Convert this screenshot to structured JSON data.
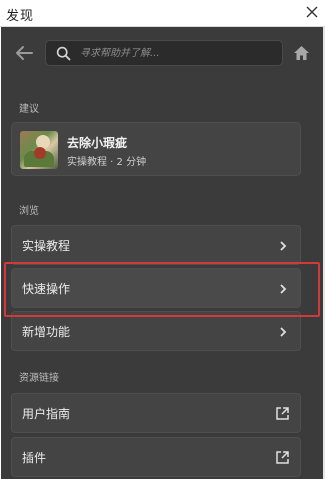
{
  "window": {
    "title": "发现"
  },
  "search": {
    "placeholder": "寻求帮助并了解..."
  },
  "sections": {
    "suggest_label": "建议",
    "browse_label": "浏览",
    "resources_label": "资源链接"
  },
  "suggestion": {
    "title": "去除小瑕疵",
    "subtitle": "实操教程 · 2 分钟"
  },
  "browse": {
    "items": [
      {
        "label": "实操教程"
      },
      {
        "label": "快速操作"
      },
      {
        "label": "新增功能"
      }
    ]
  },
  "resources": {
    "items": [
      {
        "label": "用户指南"
      },
      {
        "label": "插件"
      }
    ]
  },
  "colors": {
    "panel_bg": "#3b3b3b",
    "highlight_border": "#d23a3a"
  }
}
